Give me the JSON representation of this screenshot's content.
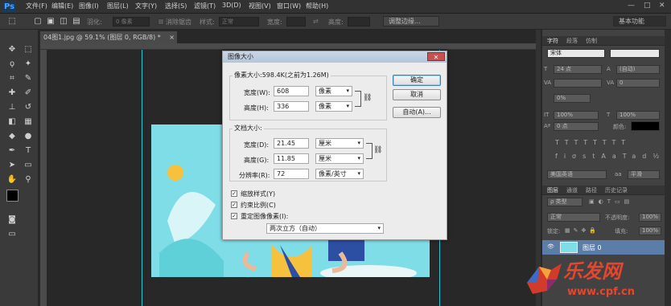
{
  "app": {
    "logo": "Ps"
  },
  "menu": [
    "文件(F)",
    "编辑(E)",
    "图像(I)",
    "图层(L)",
    "文字(Y)",
    "选择(S)",
    "滤镜(T)",
    "3D(D)",
    "视图(V)",
    "窗口(W)",
    "帮助(H)"
  ],
  "window_controls": {
    "minimize": "—",
    "restore": "□",
    "close": "✕"
  },
  "options": {
    "feather_label": "羽化:",
    "feather_value": "0 像素",
    "antialias_label": "消除锯齿",
    "style_label": "样式:",
    "style_value": "正常",
    "width_label": "宽度:",
    "height_label": "高度:",
    "refine_edge": "调整边缘...",
    "workspace": "基本功能"
  },
  "document": {
    "tab": "04图1.jpg @ 59.1% (图层 0, RGB/8) *",
    "close": "×"
  },
  "dialog": {
    "title": "图像大小",
    "close": "✕",
    "pixel_dims_label": "像素大小:598.4K(之前为1.26M)",
    "width_label": "宽度(W):",
    "width_value": "608",
    "width_unit": "像素",
    "height_label": "高度(H):",
    "height_value": "336",
    "height_unit": "像素",
    "doc_size_label": "文档大小:",
    "doc_width_label": "宽度(D):",
    "doc_width_value": "21.45",
    "doc_width_unit": "厘米",
    "doc_height_label": "高度(G):",
    "doc_height_value": "11.85",
    "doc_height_unit": "厘米",
    "resolution_label": "分辨率(R):",
    "resolution_value": "72",
    "resolution_unit": "像素/英寸",
    "scale_styles": "缩放样式(Y)",
    "constrain": "约束比例(C)",
    "resample": "重定图像像素(I):",
    "resample_method": "两次立方（自动）",
    "ok": "确定",
    "cancel": "取消",
    "auto": "自动(A)..."
  },
  "right_panel": {
    "top_tabs": [
      "字符",
      "段落",
      "仿制"
    ],
    "font_family": "宋体",
    "font_size": "24 点",
    "leading": "(自动)",
    "tracking": "0",
    "vscale": "100%",
    "hscale": "100%",
    "baseline": "0 点",
    "color_label": "颜色:",
    "language": "美国英语",
    "aa": "aa",
    "aa_mode": "平滑",
    "layer_tabs": [
      "图层",
      "通道",
      "路径",
      "历史记录"
    ],
    "kind": "ρ 类型",
    "blend": "正常",
    "opacity_label": "不透明度:",
    "opacity": "100%",
    "lock_label": "锁定:",
    "fill_label": "填充:",
    "fill": "100%",
    "layer_name": "图层 0"
  },
  "watermark": {
    "text": "乐发网",
    "url": "www.cpf.cn"
  }
}
